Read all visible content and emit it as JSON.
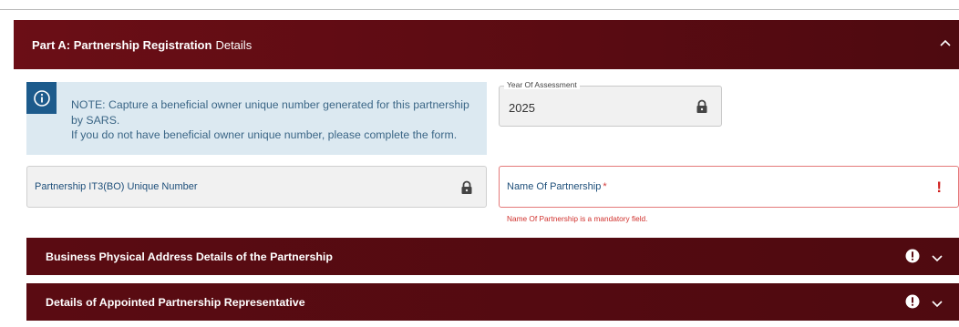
{
  "header": {
    "title_strong": "Part A: Partnership Registration",
    "title_rest": "Details"
  },
  "note": {
    "line1": "NOTE: Capture a beneficial owner unique number generated for this partnership by SARS.",
    "line2": "If you do not have beneficial owner unique number, please complete the form."
  },
  "fields": {
    "year": {
      "label": "Year Of Assessment",
      "value": "2025"
    },
    "it3": {
      "label": "Partnership IT3(BO) Unique Number"
    },
    "name": {
      "label": "Name Of Partnership",
      "required_mark": "*",
      "error_icon": "!",
      "error": "Name Of Partnership is a mandatory field."
    }
  },
  "sections": [
    {
      "title": "Business Physical Address Details of the Partnership"
    },
    {
      "title": "Details of Appointed Partnership Representative"
    }
  ],
  "colors": {
    "header_bg": "#5a0b12",
    "info_bg": "#dce9f1",
    "info_icon_bg": "#1d5b8c",
    "error": "#d0201f"
  },
  "icons": {
    "collapse": "chevron-up-icon",
    "expand": "chevron-down-icon",
    "info": "info-icon",
    "lock": "lock-icon",
    "alert": "exclamation-circle-icon"
  }
}
